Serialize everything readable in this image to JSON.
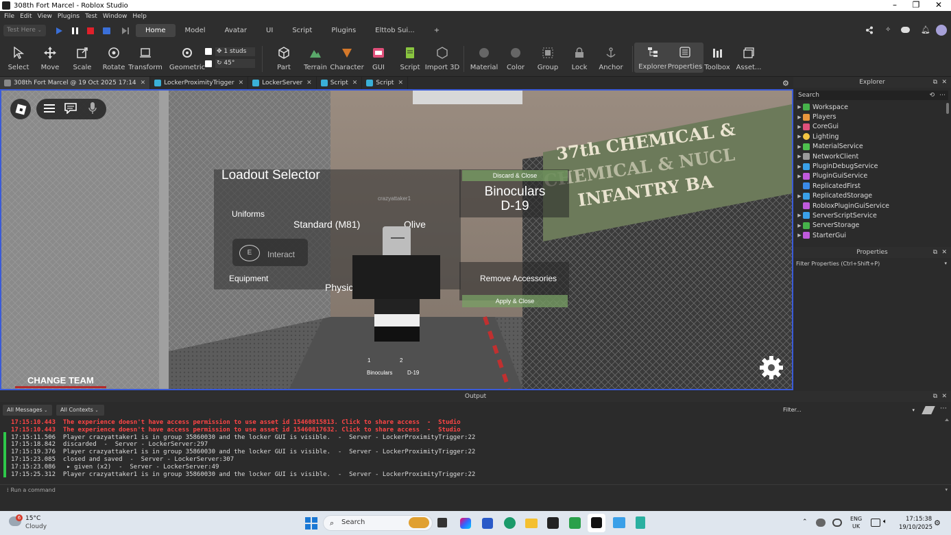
{
  "window": {
    "title": "308th Fort Marcel - Roblox Studio"
  },
  "menu": [
    "File",
    "Edit",
    "View",
    "Plugins",
    "Test",
    "Window",
    "Help"
  ],
  "ribbon": {
    "test_mode": "Test Here",
    "tabs": [
      "Home",
      "Model",
      "Avatar",
      "UI",
      "Script",
      "Plugins",
      "Elttob Sui...",
      "+"
    ]
  },
  "tools": {
    "select": "Select",
    "move": "Move",
    "scale": "Scale",
    "rotate": "Rotate",
    "transform": "Transform",
    "geometric": "Geometric",
    "studs": "1 studs",
    "degrees": "45°",
    "part": "Part",
    "terrain": "Terrain",
    "character": "Character",
    "gui": "GUI",
    "script": "Script",
    "import3d": "Import 3D",
    "material": "Material",
    "color": "Color",
    "group": "Group",
    "lock": "Lock",
    "anchor": "Anchor",
    "explorer": "Explorer",
    "properties": "Properties",
    "toolbox": "Toolbox",
    "assets": "Asset..."
  },
  "doc_tabs": [
    "308th Fort Marcel @ 19 Oct 2025 17:14",
    "LockerProximityTrigger",
    "LockerServer",
    "Script",
    "Script"
  ],
  "game": {
    "title": "Loadout Selector",
    "uniforms": "Uniforms",
    "equipment": "Equipment",
    "uniform_value": "Standard (M81)",
    "color_value": "Olive",
    "pt": "Physical Training (PT)",
    "discard": "Discard & Close",
    "apply": "Apply & Close",
    "remove": "Remove Accessories",
    "selected_item_line1": "Binoculars",
    "selected_item_line2": "D-19",
    "interact": "Interact",
    "interact_key": "E",
    "player_name": "crazyattaker1",
    "slot1_num": "1",
    "slot2_num": "2",
    "slot1_label": "Binoculars",
    "slot2_label": "D-19",
    "change_team": "CHANGE TEAM",
    "banner_line1": "37th CHEMICAL &",
    "banner_line2": "CHEMICAL & NUCL",
    "banner_line3": "INFANTRY BA"
  },
  "explorer": {
    "title": "Explorer",
    "search": "Search",
    "items": [
      {
        "name": "Workspace",
        "color": "#46b34a"
      },
      {
        "name": "Players",
        "color": "#e8963c"
      },
      {
        "name": "CoreGui",
        "color": "#e0507a"
      },
      {
        "name": "Lighting",
        "color": "#f4c542"
      },
      {
        "name": "MaterialService",
        "color": "#4ec04e"
      },
      {
        "name": "NetworkClient",
        "color": "#9a9a9a"
      },
      {
        "name": "PluginDebugService",
        "color": "#3aa0e8"
      },
      {
        "name": "PluginGuiService",
        "color": "#c05adc"
      },
      {
        "name": "ReplicatedFirst",
        "color": "#3a8ae8"
      },
      {
        "name": "ReplicatedStorage",
        "color": "#3aa0e8"
      },
      {
        "name": "RobloxPluginGuiService",
        "color": "#c05adc"
      },
      {
        "name": "ServerScriptService",
        "color": "#3aa0e8"
      },
      {
        "name": "ServerStorage",
        "color": "#46b34a"
      },
      {
        "name": "StarterGui",
        "color": "#c05adc"
      }
    ]
  },
  "properties": {
    "title": "Properties",
    "filter": "Filter Properties (Ctrl+Shift+P)"
  },
  "output": {
    "title": "Output",
    "all_messages": "All Messages",
    "all_contexts": "All Contexts",
    "filter": "Filter...",
    "lines": [
      {
        "t": "17:15:10.443  The experience doesn't have access permission to use asset id 15460815813. Click to share access  -  Studio",
        "err": true
      },
      {
        "t": "17:15:10.443  The experience doesn't have access permission to use asset id 15460817632. Click to share access  -  Studio",
        "err": true
      },
      {
        "t": "17:15:11.506  Player crazyattaker1 is in group 35860030 and the locker GUI is visible.  -  Server - LockerProximityTrigger:22",
        "err": false
      },
      {
        "t": "17:15:18.842  discarded  -  Server - LockerServer:297",
        "err": false
      },
      {
        "t": "17:15:19.376  Player crazyattaker1 is in group 35860030 and the locker GUI is visible.  -  Server - LockerProximityTrigger:22",
        "err": false
      },
      {
        "t": "17:15:23.085  closed and saved  -  Server - LockerServer:307",
        "err": false
      },
      {
        "t": "17:15:23.086   ▸ given (x2)  -  Server - LockerServer:49",
        "err": false
      },
      {
        "t": "17:15:25.312  Player crazyattaker1 is in group 35860030 and the locker GUI is visible.  -  Server - LockerProximityTrigger:22",
        "err": false
      }
    ],
    "command": "Run a command"
  },
  "taskbar": {
    "temp": "15°C",
    "weather": "Cloudy",
    "badge": "6",
    "search": "Search",
    "lang1": "ENG",
    "lang2": "UK",
    "time": "17:15:38",
    "date": "19/10/2025"
  }
}
